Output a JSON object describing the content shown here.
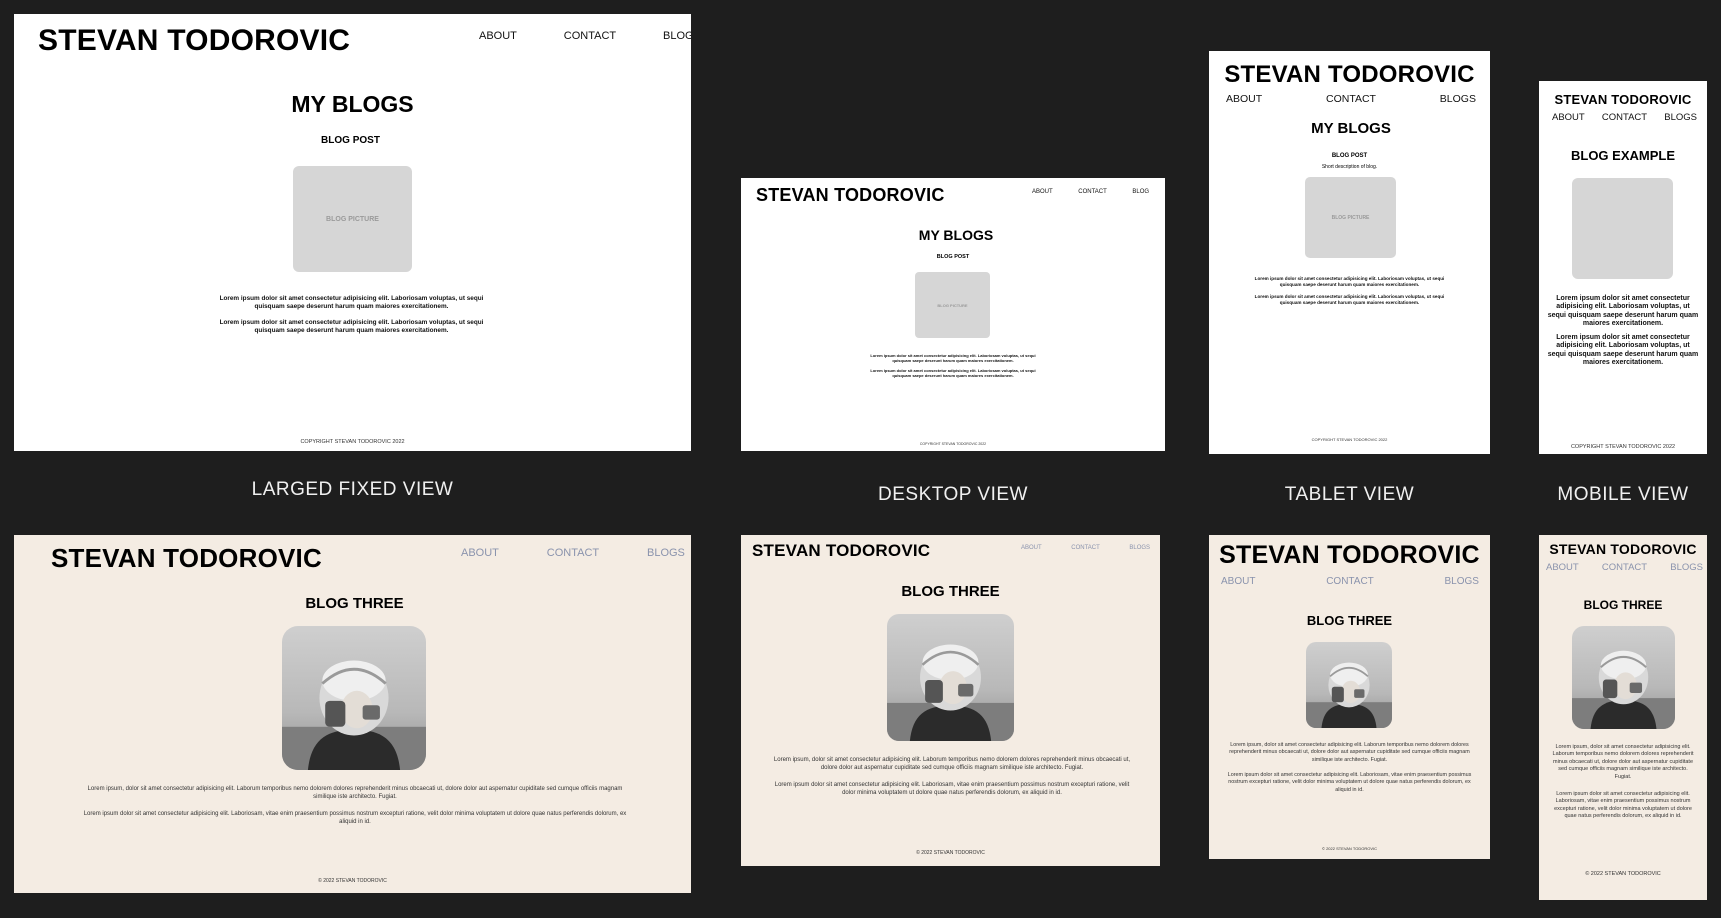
{
  "brand": "STEVAN TODOROVIC",
  "nav": {
    "about": "ABOUT",
    "contact": "CONTACT",
    "blog": "BLOG",
    "blogs": "BLOGS"
  },
  "wireframe": {
    "page_title": "MY BLOGS",
    "post_label": "BLOG POST",
    "short_description": "Short description of blog.",
    "picture_label": "BLOG PICTURE",
    "example_title": "BLOG EXAMPLE",
    "lorem": "Lorem ipsum dolor sit amet consectetur adipisicing elit. Laboriosam voluptas, ut sequi quisquam saepe deserunt harum quam maiores exercitationem.",
    "copyright": "COPYRIGHT STEVAN TODOROVIC 2022"
  },
  "final": {
    "title": "BLOG THREE",
    "p1": "Lorem ipsum, dolor sit amet consectetur adipisicing elit. Laborum temporibus nemo dolorem dolores reprehenderit minus obcaecati ut, dolore dolor aut aspernatur cupiditate sed cumque officiis magnam similique iste architecto. Fugiat.",
    "p2": "Lorem ipsum dolor sit amet consectetur adipisicing elit. Laboriosam, vitae enim praesentium possimus nostrum excepturi ratione, velit dolor minima voluptatem ut dolore quae natus perferendis dolorum, ex aliquid in id.",
    "copyright": "© 2022 STEVAN TODOROVIC"
  },
  "captions": {
    "large": "LARGED FIXED VIEW",
    "desktop": "DESKTOP VIEW",
    "tablet": "TABLET VIEW",
    "mobile": "MOBILE VIEW"
  },
  "colors": {
    "canvas": "#1e1e1e",
    "wireframe_bg": "#ffffff",
    "final_bg": "#f4ece3",
    "nav_final": "#8a93ad",
    "placeholder": "#d6d6d6"
  }
}
